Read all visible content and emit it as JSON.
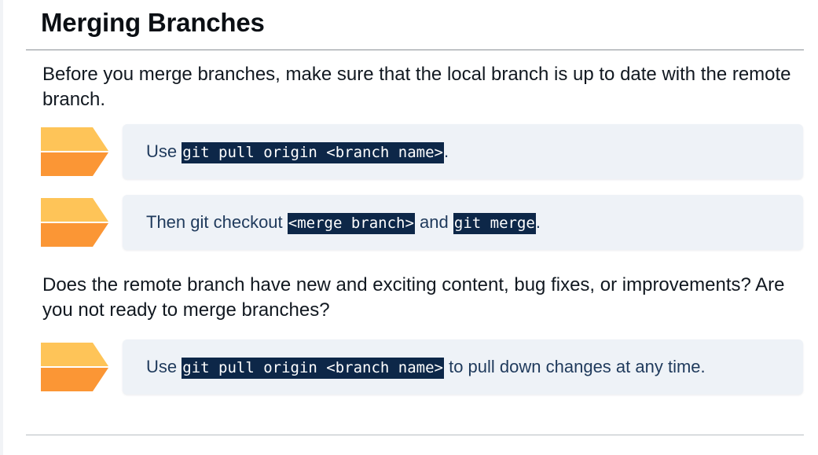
{
  "slide": {
    "title": "Merging Branches",
    "intro": "Before you merge branches, make sure that the local branch is up to date with the remote branch.",
    "question": "Does the remote branch have new and exciting content, bug fixes, or improvements? Are you not ready to merge branches?"
  },
  "steps": [
    {
      "icon": "chevron-arrow-icon",
      "prefix": "Use ",
      "code1": "git pull origin <branch name>",
      "suffix": "."
    },
    {
      "icon": "chevron-arrow-icon",
      "prefix": "Then git checkout ",
      "code1": "<merge branch>",
      "middle": " and ",
      "code2": "git merge",
      "suffix": "."
    },
    {
      "icon": "chevron-arrow-icon",
      "prefix": "Use ",
      "code1": "git pull origin <branch name>",
      "suffix": " to pull down changes at any time."
    }
  ],
  "colors": {
    "chevron_top": "#fec458",
    "chevron_bottom": "#fb9635",
    "card_background": "#eef2f7",
    "code_background": "#0d2748",
    "card_text": "#1f3a5c"
  }
}
